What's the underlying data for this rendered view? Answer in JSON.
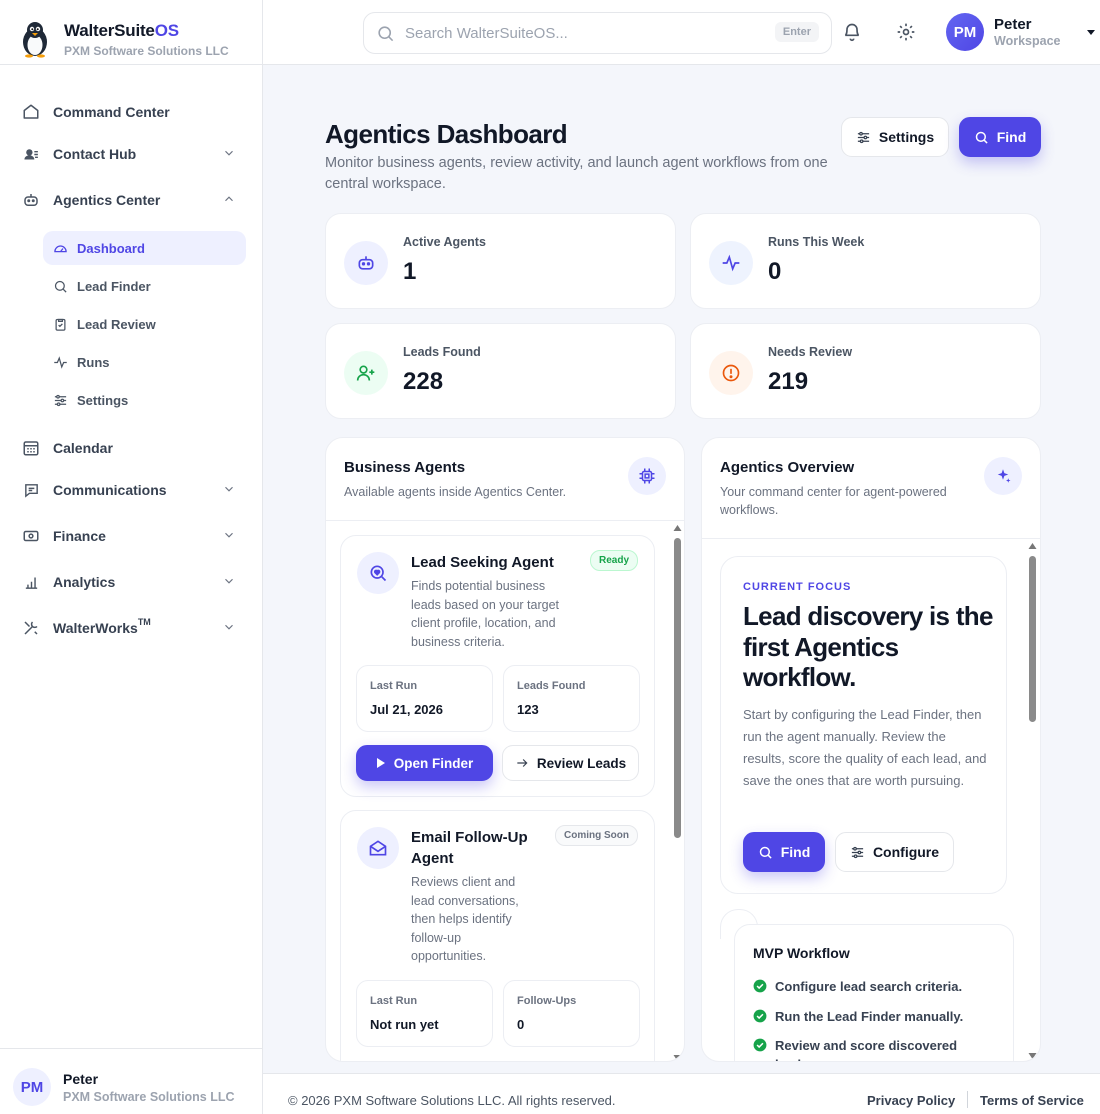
{
  "brand": {
    "name": "WalterSuite",
    "name_suffix": "OS",
    "company": "PXM Software Solutions LLC"
  },
  "search": {
    "placeholder": "Search WalterSuiteOS...",
    "shortcut": "Enter"
  },
  "user": {
    "initials": "PM",
    "name": "Peter",
    "workspace": "Workspace",
    "company": "PXM Software Solutions LLC"
  },
  "sidebar": {
    "items": [
      {
        "label": "Command Center",
        "icon": "home-icon"
      },
      {
        "label": "Contact Hub",
        "icon": "contacts-icon"
      },
      {
        "label": "Agentics Center",
        "icon": "robot-icon"
      },
      {
        "label": "Calendar",
        "icon": "calendar-icon"
      },
      {
        "label": "Communications",
        "icon": "message-icon"
      },
      {
        "label": "Finance",
        "icon": "money-icon"
      },
      {
        "label": "Analytics",
        "icon": "bar-chart-icon"
      },
      {
        "label": "WalterWorks",
        "label_mark": "TM",
        "icon": "tools-icon"
      }
    ],
    "agentics_sub": [
      {
        "label": "Dashboard",
        "icon": "gauge-icon"
      },
      {
        "label": "Lead Finder",
        "icon": "search-icon"
      },
      {
        "label": "Lead Review",
        "icon": "clipboard-check-icon"
      },
      {
        "label": "Runs",
        "icon": "activity-icon"
      },
      {
        "label": "Settings",
        "icon": "sliders-icon"
      }
    ]
  },
  "page": {
    "title": "Agentics Dashboard",
    "subtitle": "Monitor business agents, review activity, and launch agent workflows from one central workspace.",
    "settings_label": "Settings",
    "find_label": "Find"
  },
  "stats": [
    {
      "label": "Active Agents",
      "value": "1",
      "icon": "robot-icon",
      "color": "#4f46e5"
    },
    {
      "label": "Runs This Week",
      "value": "0",
      "icon": "activity-icon",
      "color": "#4f46e5"
    },
    {
      "label": "Leads Found",
      "value": "228",
      "icon": "user-plus-icon",
      "color": "#16a34a"
    },
    {
      "label": "Needs Review",
      "value": "219",
      "icon": "alert-circle-icon",
      "color": "#ea580c"
    }
  ],
  "business_agents": {
    "title": "Business Agents",
    "subtitle": "Available agents inside Agentics Center.",
    "agents": [
      {
        "name": "Lead Seeking Agent",
        "badge": "Ready",
        "description": "Finds potential business leads based on your target client profile, location, and business criteria.",
        "stat1_label": "Last Run",
        "stat1_value": "Jul 21, 2026",
        "stat2_label": "Leads Found",
        "stat2_value": "123",
        "primary_label": "Open Finder",
        "secondary_label": "Review Leads"
      },
      {
        "name": "Email Follow-Up Agent",
        "badge": "Coming Soon",
        "description": "Reviews client and lead conversations, then helps identify follow-up opportunities.",
        "stat1_label": "Last Run",
        "stat1_value": "Not run yet",
        "stat2_label": "Follow-Ups",
        "stat2_value": "0"
      }
    ]
  },
  "overview": {
    "title": "Agentics Overview",
    "subtitle": "Your command center for agent-powered workflows.",
    "eyebrow": "CURRENT FOCUS",
    "headline": "Lead discovery is the first Agentics workflow.",
    "body": "Start by configuring the Lead Finder, then run the agent manually. Review the results, score the quality of each lead, and save the ones that are worth pursuing.",
    "find_label": "Find",
    "configure_label": "Configure",
    "workflow_title": "MVP Workflow",
    "workflow_steps": [
      "Configure lead search criteria.",
      "Run the Lead Finder manually.",
      "Review and score discovered leads."
    ]
  },
  "footer": {
    "copyright": "© 2026 PXM Software Solutions LLC. All rights reserved.",
    "privacy": "Privacy Policy",
    "terms": "Terms of Service"
  },
  "colors": {
    "accent": "#4f46e5",
    "success": "#16a34a",
    "warning": "#ea580c"
  }
}
